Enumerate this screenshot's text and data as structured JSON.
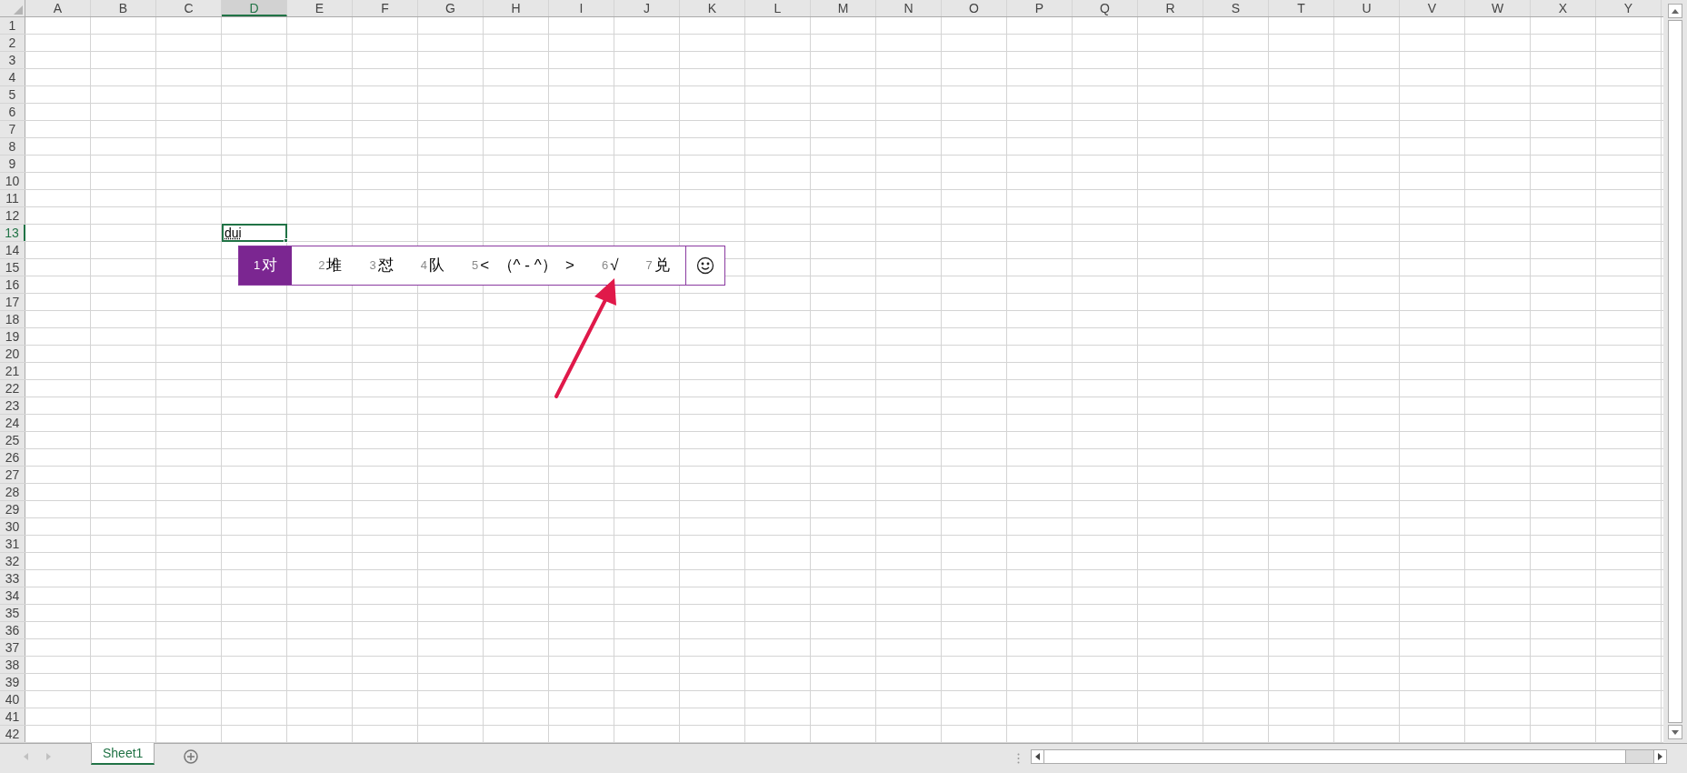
{
  "columns": [
    {
      "label": "A",
      "selected": false
    },
    {
      "label": "B",
      "selected": false
    },
    {
      "label": "C",
      "selected": false
    },
    {
      "label": "D",
      "selected": true
    },
    {
      "label": "E",
      "selected": false
    },
    {
      "label": "F",
      "selected": false
    },
    {
      "label": "G",
      "selected": false
    },
    {
      "label": "H",
      "selected": false
    },
    {
      "label": "I",
      "selected": false
    },
    {
      "label": "J",
      "selected": false
    },
    {
      "label": "K",
      "selected": false
    },
    {
      "label": "L",
      "selected": false
    },
    {
      "label": "M",
      "selected": false
    },
    {
      "label": "N",
      "selected": false
    },
    {
      "label": "O",
      "selected": false
    },
    {
      "label": "P",
      "selected": false
    },
    {
      "label": "Q",
      "selected": false
    },
    {
      "label": "R",
      "selected": false
    },
    {
      "label": "S",
      "selected": false
    },
    {
      "label": "T",
      "selected": false
    },
    {
      "label": "U",
      "selected": false
    },
    {
      "label": "V",
      "selected": false
    },
    {
      "label": "W",
      "selected": false
    },
    {
      "label": "X",
      "selected": false
    },
    {
      "label": "Y",
      "selected": false
    }
  ],
  "rows": [
    {
      "label": "1",
      "selected": false
    },
    {
      "label": "2",
      "selected": false
    },
    {
      "label": "3",
      "selected": false
    },
    {
      "label": "4",
      "selected": false
    },
    {
      "label": "5",
      "selected": false
    },
    {
      "label": "6",
      "selected": false
    },
    {
      "label": "7",
      "selected": false
    },
    {
      "label": "8",
      "selected": false
    },
    {
      "label": "9",
      "selected": false
    },
    {
      "label": "10",
      "selected": false
    },
    {
      "label": "11",
      "selected": false
    },
    {
      "label": "12",
      "selected": false
    },
    {
      "label": "13",
      "selected": true
    },
    {
      "label": "14",
      "selected": false
    },
    {
      "label": "15",
      "selected": false
    },
    {
      "label": "16",
      "selected": false
    },
    {
      "label": "17",
      "selected": false
    },
    {
      "label": "18",
      "selected": false
    },
    {
      "label": "19",
      "selected": false
    },
    {
      "label": "20",
      "selected": false
    },
    {
      "label": "21",
      "selected": false
    },
    {
      "label": "22",
      "selected": false
    },
    {
      "label": "23",
      "selected": false
    },
    {
      "label": "24",
      "selected": false
    },
    {
      "label": "25",
      "selected": false
    },
    {
      "label": "26",
      "selected": false
    },
    {
      "label": "27",
      "selected": false
    },
    {
      "label": "28",
      "selected": false
    },
    {
      "label": "29",
      "selected": false
    },
    {
      "label": "30",
      "selected": false
    },
    {
      "label": "31",
      "selected": false
    },
    {
      "label": "32",
      "selected": false
    },
    {
      "label": "33",
      "selected": false
    },
    {
      "label": "34",
      "selected": false
    },
    {
      "label": "35",
      "selected": false
    },
    {
      "label": "36",
      "selected": false
    },
    {
      "label": "37",
      "selected": false
    },
    {
      "label": "38",
      "selected": false
    },
    {
      "label": "39",
      "selected": false
    },
    {
      "label": "40",
      "selected": false
    },
    {
      "label": "41",
      "selected": false
    },
    {
      "label": "42",
      "selected": false
    }
  ],
  "active_cell": {
    "value": "dui"
  },
  "ime_candidates": [
    {
      "index": "1",
      "text": "对",
      "selected": true
    },
    {
      "index": "2",
      "text": "堆",
      "selected": false
    },
    {
      "index": "3",
      "text": "怼",
      "selected": false
    },
    {
      "index": "4",
      "text": "队",
      "selected": false
    },
    {
      "index": "5",
      "text": "<  （^ - ^）  >",
      "selected": false
    },
    {
      "index": "6",
      "text": "√",
      "selected": false
    },
    {
      "index": "7",
      "text": "兑",
      "selected": false
    }
  ],
  "sheet_tabs": [
    {
      "label": "Sheet1",
      "selected": true
    }
  ]
}
